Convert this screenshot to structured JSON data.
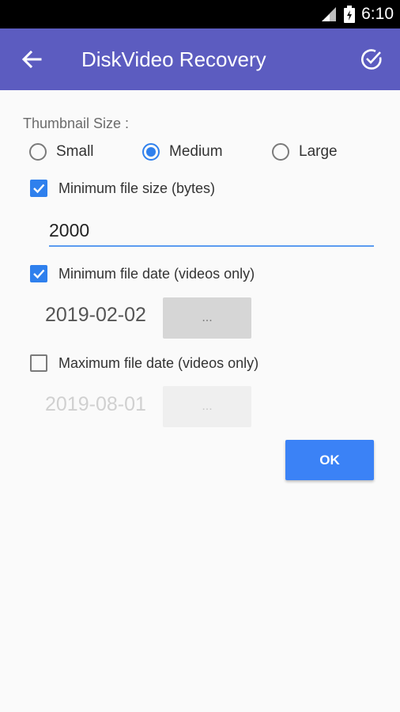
{
  "status_bar": {
    "time": "6:10",
    "icons": [
      "signal-icon",
      "battery-icon"
    ]
  },
  "app_bar": {
    "title": "DiskVideo Recovery",
    "back_icon": "arrow-left-icon",
    "confirm_icon": "check-circle-icon",
    "color": "#5c5cc0"
  },
  "thumbnail": {
    "label": "Thumbnail Size :",
    "options": [
      {
        "label": "Small",
        "selected": false
      },
      {
        "label": "Medium",
        "selected": true
      },
      {
        "label": "Large",
        "selected": false
      }
    ]
  },
  "min_size": {
    "label": "Minimum file size (bytes)",
    "checked": true,
    "value": "2000"
  },
  "min_date": {
    "label": "Minimum file date (videos only)",
    "checked": true,
    "value": "2019-02-02",
    "button": "..."
  },
  "max_date": {
    "label": "Maximum file date (videos only)",
    "checked": false,
    "value": "2019-08-01",
    "button": "..."
  },
  "ok_button": {
    "label": "OK"
  },
  "colors": {
    "accent": "#2f80ed",
    "ok_button": "#3b82f6",
    "disabled_text": "#d0d0d0"
  }
}
